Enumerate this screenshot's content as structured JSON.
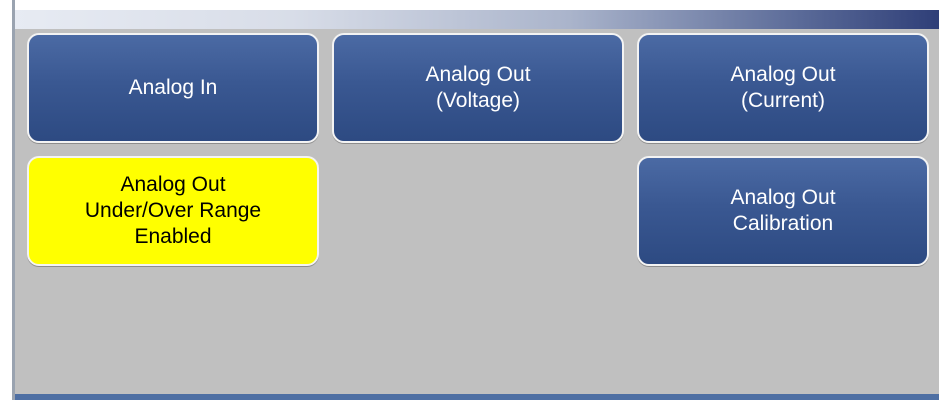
{
  "buttons": {
    "analog_in": "Analog In",
    "analog_out_voltage": "Analog Out\n(Voltage)",
    "analog_out_current": "Analog Out\n(Current)",
    "under_over_range": "Analog Out\nUnder/Over Range\nEnabled",
    "analog_out_calibration": "Analog Out\nCalibration"
  },
  "colors": {
    "panel_background": "#c0c0c0",
    "button_blue": "#3a5892",
    "button_highlight_yellow": "#ffff00",
    "bottom_bar": "#4e6fa3"
  }
}
